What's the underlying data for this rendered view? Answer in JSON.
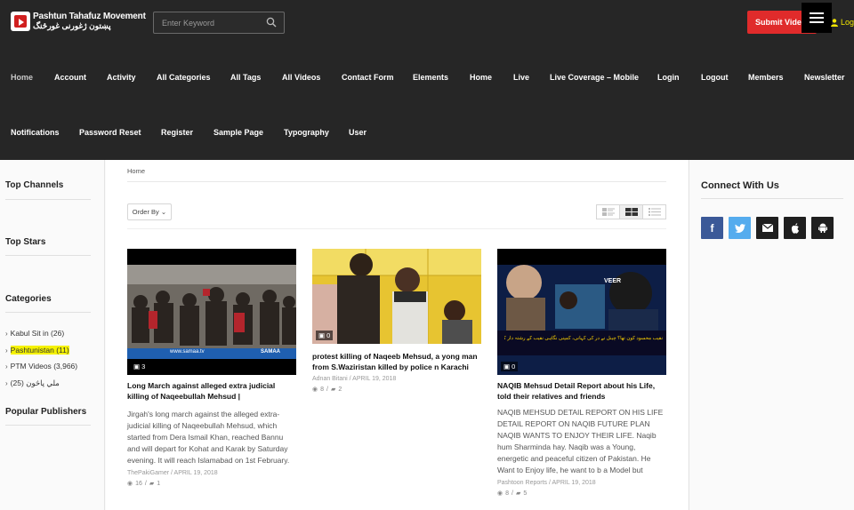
{
  "brand": {
    "name_en": "Pashtun Tahafuz Movement",
    "name_ur": "پښتون ژغورنی غورځنگ"
  },
  "search": {
    "placeholder": "Enter Keyword"
  },
  "header": {
    "submit_label": "Submit Video",
    "login_label": "Login"
  },
  "nav": {
    "row1": [
      "Home",
      "Account",
      "Activity",
      "All Categories",
      "All Tags",
      "All Videos",
      "Contact Form",
      "Elements",
      "Home",
      "Live",
      "Live Coverage – Mobile",
      "Login",
      "Logout",
      "Members",
      "Newsletter"
    ],
    "row2": [
      "Notifications",
      "Password Reset",
      "Register",
      "Sample Page",
      "Typography",
      "User"
    ]
  },
  "left_sidebar": {
    "top_channels": "Top Channels",
    "top_stars": "Top Stars",
    "categories_title": "Categories",
    "categories": [
      {
        "label": "Kabul Sit in",
        "count": "(26)"
      },
      {
        "label": "Pashtunistan",
        "count": "(11)"
      },
      {
        "label": "PTM Videos",
        "count": "(3,966)"
      },
      {
        "label": "ملي پاڅون",
        "count": "(25)"
      }
    ],
    "popular_publishers": "Popular Publishers"
  },
  "right_sidebar": {
    "title": "Connect With Us"
  },
  "main": {
    "breadcrumb": "Home",
    "order_label": "Order By",
    "cards": [
      {
        "badge": "3",
        "title": "Long March against alleged extra judicial killing of Naqeebullah Mehsud |",
        "excerpt": "Jirgah's long march against the alleged extra-judicial killing of Naqeebullah Mehsud, which started from Dera Ismail Khan, reached Bannu and will depart for Kohat and Karak by Saturday evening. It will reach Islamabad on 1st February.",
        "author": "ThePakiGamer",
        "date": "APRIL 19, 2018",
        "views": "16",
        "comments": "1",
        "thumb_caption": "www.samaa.tv",
        "thumb_logo": "SAMAA"
      },
      {
        "badge": "0",
        "title": "protest killing of Naqeeb Mehsud, a yong man from S.Waziristan killed by police n Karachi",
        "excerpt": "",
        "author": "Adnan Bitani",
        "date": "APRIL 19, 2018",
        "views": "8",
        "comments": "2"
      },
      {
        "badge": "0",
        "title": "NAQIB Mehsud Detail Report about his Life, told their relatives and friends",
        "excerpt": "NAQIB MEHSUD DETAIL REPORT ON HIS LIFE DETAIL REPORT ON NAQIB FUTURE PLAN NAQIB WANTS TO ENJOY THEIR LIFE. Naqib hum Sharminda hay. Naqib was a Young, energetic and peaceful citizen of Pakistan. He Want to Enjoy life, he want to b a Model but",
        "author": "Pashtoon Reports",
        "date": "APRIL 19, 2018",
        "views": "8",
        "comments": "5",
        "thumb_caption": "نقیب محسود کون تھا؟ چینل نے در کی کہانی، کمپنی نگاہی نقیب کے رشتہ دار کی بھی شمسی گفتگو ۔ قتل کیوں کیا؟",
        "thumb_label": "VEER"
      }
    ]
  },
  "colors": {
    "header_bg": "#262626",
    "accent_red": "#e02b2b",
    "login_yellow": "#f2e600",
    "highlight": "#f5f200"
  }
}
